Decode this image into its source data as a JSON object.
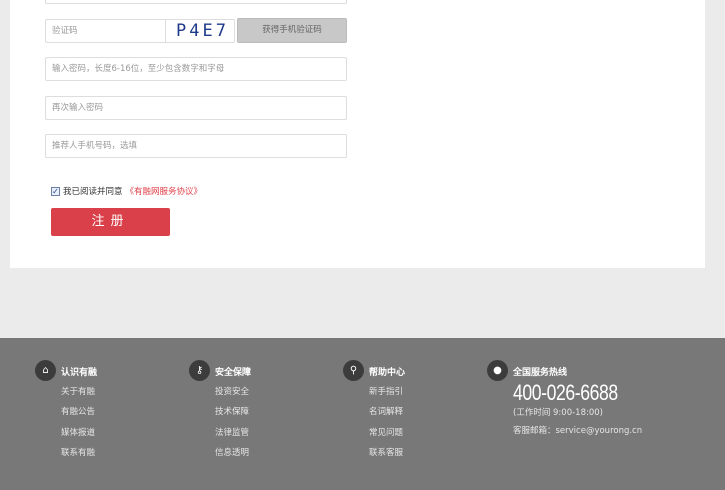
{
  "form": {
    "captcha_placeholder": "验证码",
    "captcha_text": "P4E7",
    "sms_button": "获得手机验证码",
    "password_placeholder": "输入密码，长度6-16位，至少包含数字和字母",
    "confirm_placeholder": "再次输入密码",
    "referrer_placeholder": "推荐人手机号码，选填",
    "agree_text": "我已阅读并同意",
    "agree_link": "《有融网服务协议》",
    "agree_checked": true,
    "register_button": "注册"
  },
  "footer": {
    "columns": [
      {
        "title": "认识有融",
        "icon": "home-icon",
        "links": [
          "关于有融",
          "有融公告",
          "媒体报道",
          "联系有融"
        ]
      },
      {
        "title": "安全保障",
        "icon": "key-icon",
        "links": [
          "投资安全",
          "技术保障",
          "法律监管",
          "信息透明"
        ]
      },
      {
        "title": "帮助中心",
        "icon": "search-icon",
        "links": [
          "新手指引",
          "名词解释",
          "常见问题",
          "联系客服"
        ]
      }
    ],
    "hotline": {
      "title": "全国服务热线",
      "icon": "user-icon",
      "phone": "400-026-6688",
      "hours": "(工作时间 9:00-18:00)",
      "email": "客服邮箱：service@yourong.cn"
    }
  }
}
